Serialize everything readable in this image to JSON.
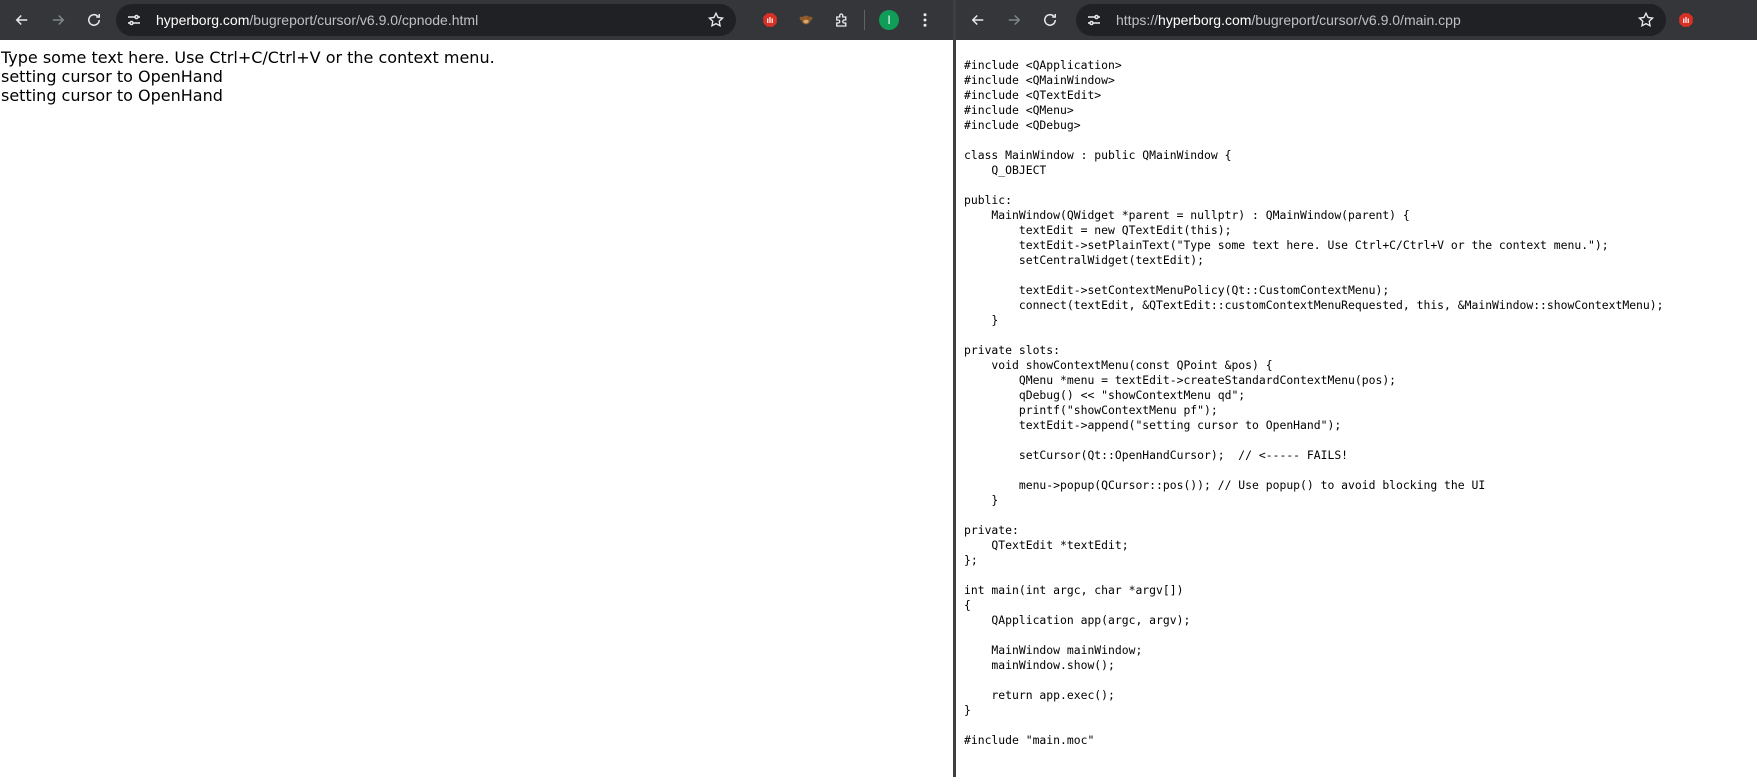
{
  "left_window": {
    "url_host": "hyperborg.com",
    "url_path": "/bugreport/cursor/v6.9.0/cpnode.html",
    "profile_initial": "I",
    "content_lines": [
      "Type some text here. Use Ctrl+C/Ctrl+V or the context menu.",
      "setting cursor to OpenHand",
      "setting cursor to OpenHand"
    ]
  },
  "right_window": {
    "url_scheme": "https://",
    "url_host": "hyperborg.com",
    "url_path": "/bugreport/cursor/v6.9.0/main.cpp",
    "code": "#include <QApplication>\n#include <QMainWindow>\n#include <QTextEdit>\n#include <QMenu>\n#include <QDebug>\n\nclass MainWindow : public QMainWindow {\n    Q_OBJECT\n\npublic:\n    MainWindow(QWidget *parent = nullptr) : QMainWindow(parent) {\n        textEdit = new QTextEdit(this);\n        textEdit->setPlainText(\"Type some text here. Use Ctrl+C/Ctrl+V or the context menu.\");\n        setCentralWidget(textEdit);\n\n        textEdit->setContextMenuPolicy(Qt::CustomContextMenu);\n        connect(textEdit, &QTextEdit::customContextMenuRequested, this, &MainWindow::showContextMenu);\n    }\n\nprivate slots:\n    void showContextMenu(const QPoint &pos) {\n        QMenu *menu = textEdit->createStandardContextMenu(pos);\n        qDebug() << \"showContextMenu qd\";\n        printf(\"showContextMenu pf\");\n        textEdit->append(\"setting cursor to OpenHand\");\n\n        setCursor(Qt::OpenHandCursor);  // <----- FAILS!\n\n        menu->popup(QCursor::pos()); // Use popup() to avoid blocking the UI\n    }\n\nprivate:\n    QTextEdit *textEdit;\n};\n\nint main(int argc, char *argv[])\n{\n    QApplication app(argc, argv);\n\n    MainWindow mainWindow;\n    mainWindow.show();\n\n    return app.exec();\n}\n\n#include \"main.moc\""
  },
  "colors": {
    "toolbar_bg": "#35363a",
    "omnibox_bg": "#202124",
    "profile_bg": "#0f9d58",
    "stop_ext": "#d93025"
  }
}
